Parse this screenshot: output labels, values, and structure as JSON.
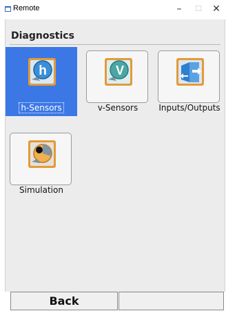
{
  "window": {
    "title": "Remote",
    "minimize_glyph": "–",
    "maximize_glyph": "☐",
    "close_glyph": "✕"
  },
  "header": {
    "title": "Diagnostics"
  },
  "tiles": [
    {
      "label": "h-Sensors",
      "icon": "h-sensors-icon",
      "selected": true
    },
    {
      "label": "v-Sensors",
      "icon": "v-sensors-icon",
      "selected": false
    },
    {
      "label": "Inputs/Outputs",
      "icon": "inputs-outputs-icon",
      "selected": false
    },
    {
      "label": "Simulation",
      "icon": "simulation-icon",
      "selected": false
    }
  ],
  "footer": {
    "back_label": "Back",
    "right_label": ""
  },
  "colors": {
    "selection": "#3b78e6",
    "icon_frame": "#e39a3a",
    "icon_blue": "#3b8fd8",
    "icon_teal": "#4aa7a5"
  }
}
